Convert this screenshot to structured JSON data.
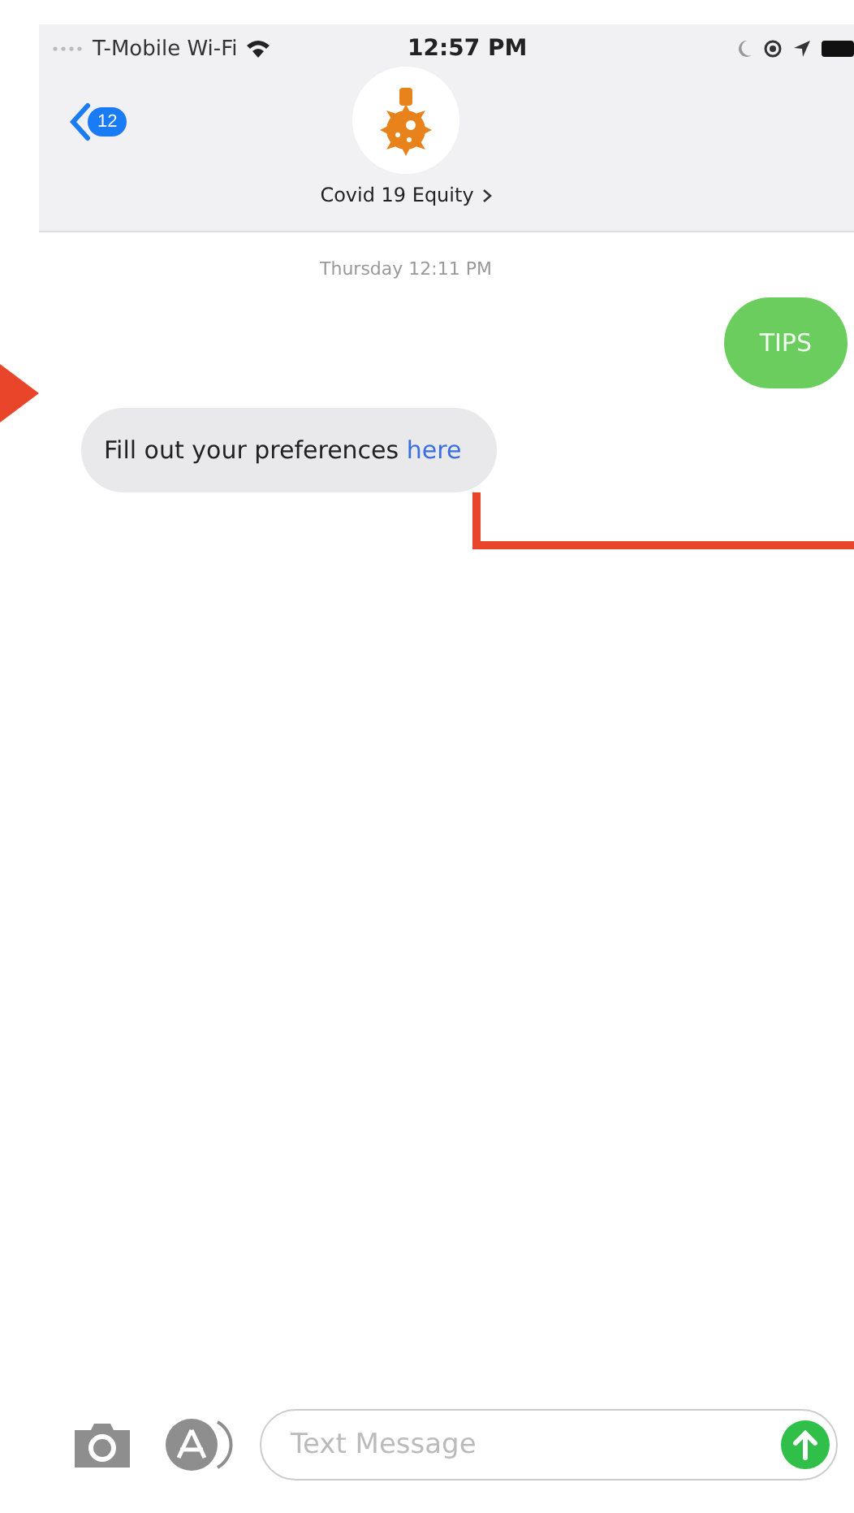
{
  "status_bar": {
    "carrier": "T-Mobile Wi-Fi",
    "time": "12:57 PM"
  },
  "nav": {
    "back_count": "12",
    "contact_name": "Covid 19 Equity"
  },
  "timestamp": "Thursday 12:11 PM",
  "messages": [
    {
      "kind": "sent",
      "text": "TIPS"
    },
    {
      "kind": "received",
      "text": "Fill out your preferences",
      "link": "here"
    }
  ],
  "composer": {
    "placeholder": "Text Message"
  }
}
